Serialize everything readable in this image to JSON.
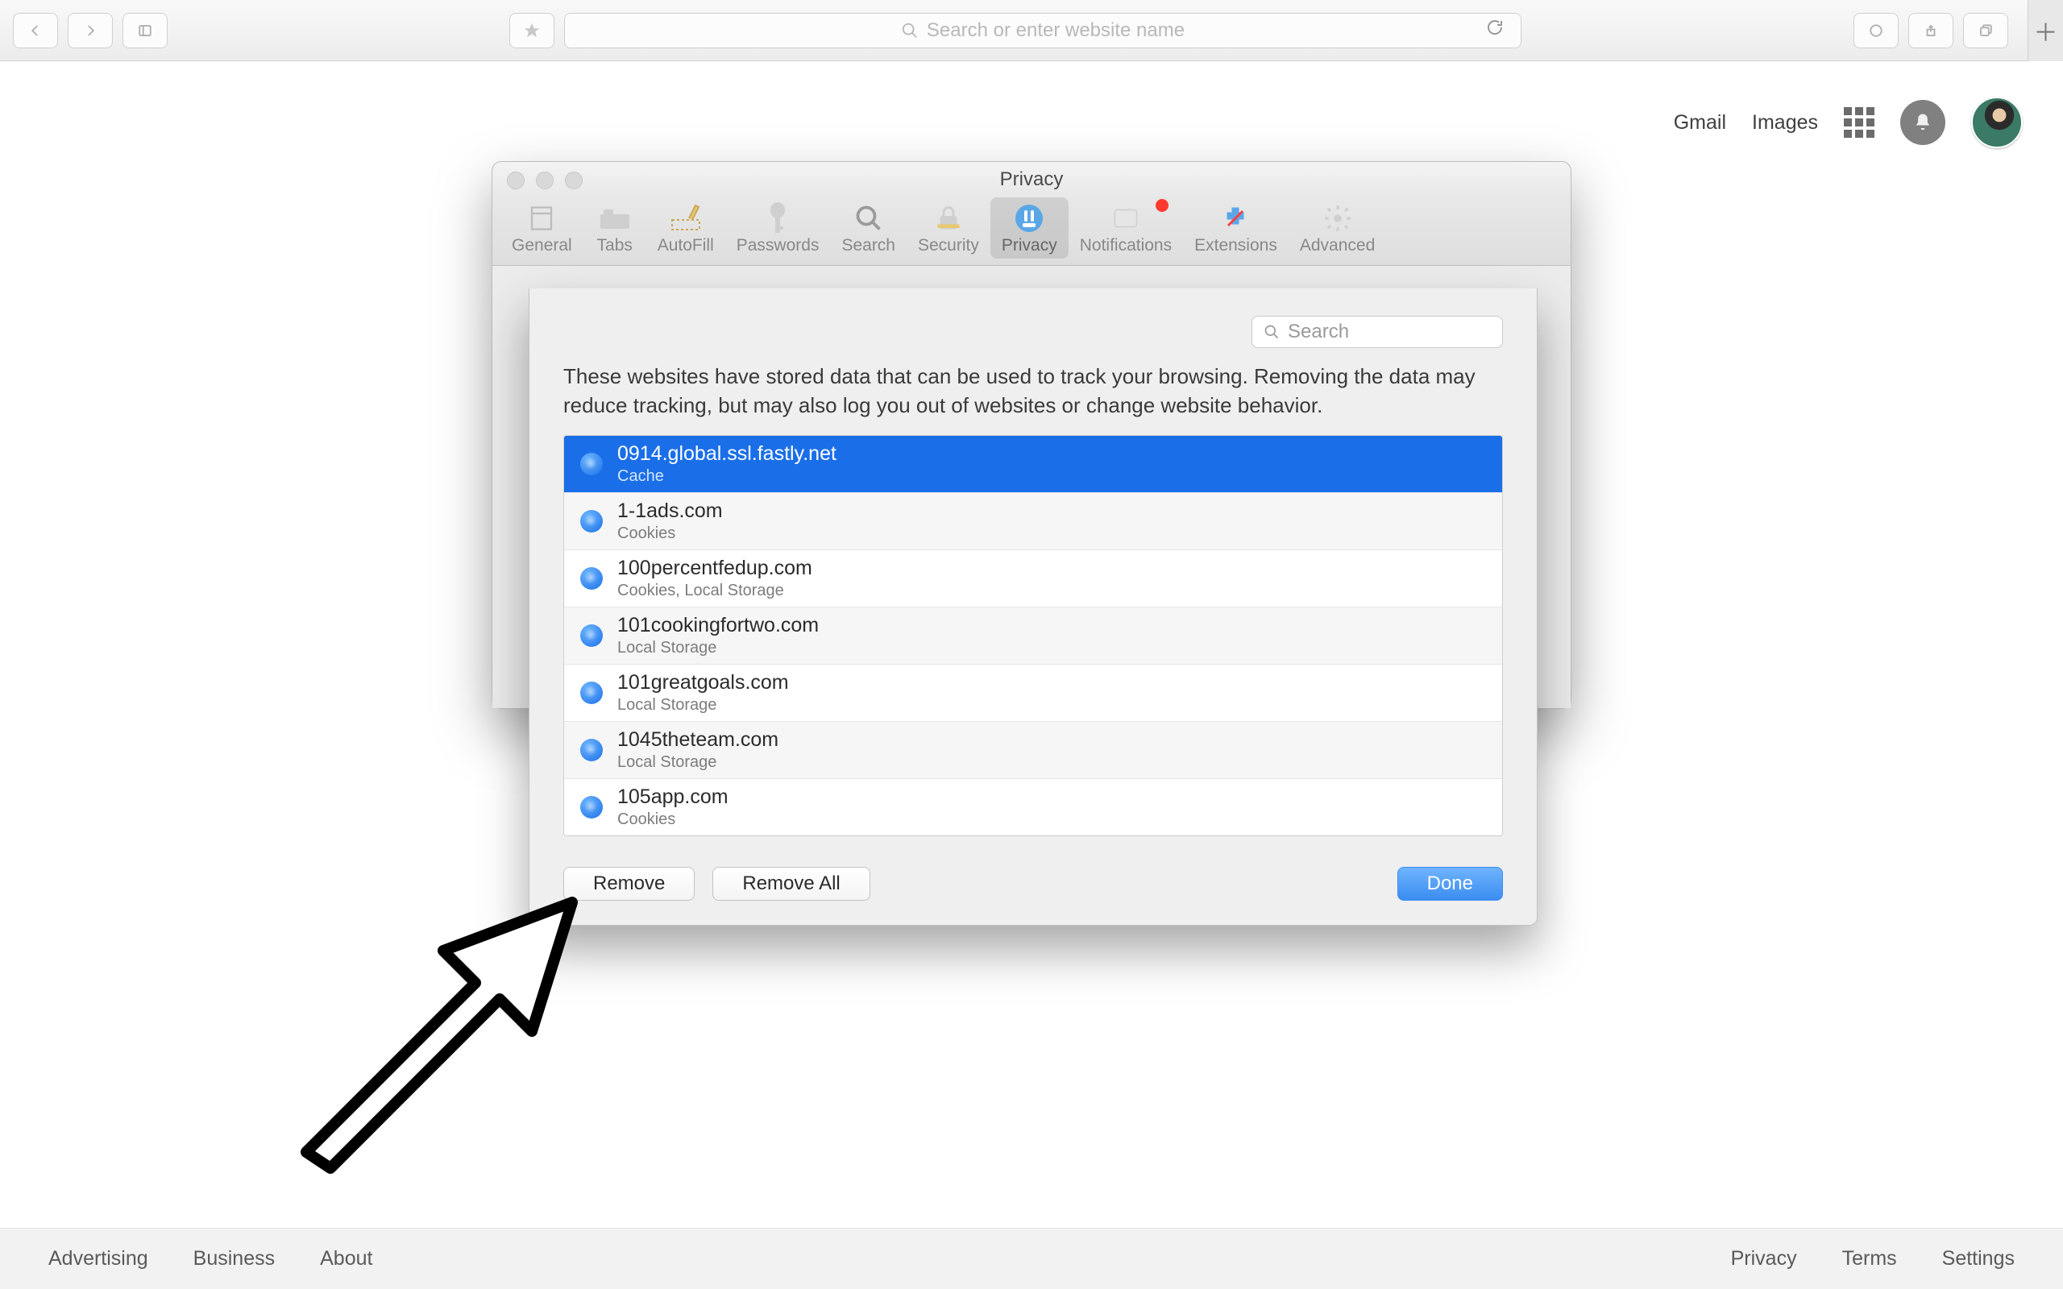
{
  "browser": {
    "url_placeholder": "Search or enter website name"
  },
  "google": {
    "header": {
      "gmail": "Gmail",
      "images": "Images"
    },
    "footer": {
      "advertising": "Advertising",
      "business": "Business",
      "about": "About",
      "privacy": "Privacy",
      "terms": "Terms",
      "settings": "Settings"
    }
  },
  "prefs": {
    "title": "Privacy",
    "tabs": {
      "general": "General",
      "tabs": "Tabs",
      "autofill": "AutoFill",
      "passwords": "Passwords",
      "search": "Search",
      "security": "Security",
      "privacy": "Privacy",
      "notifications": "Notifications",
      "extensions": "Extensions",
      "advanced": "Advanced"
    }
  },
  "sheet": {
    "search_placeholder": "Search",
    "description": "These websites have stored data that can be used to track your browsing. Removing the data may reduce tracking, but may also log you out of websites or change website behavior.",
    "sites": [
      {
        "domain": "0914.global.ssl.fastly.net",
        "detail": "Cache",
        "selected": true
      },
      {
        "domain": "1-1ads.com",
        "detail": "Cookies",
        "selected": false
      },
      {
        "domain": "100percentfedup.com",
        "detail": "Cookies, Local Storage",
        "selected": false
      },
      {
        "domain": "101cookingfortwo.com",
        "detail": "Local Storage",
        "selected": false
      },
      {
        "domain": "101greatgoals.com",
        "detail": "Local Storage",
        "selected": false
      },
      {
        "domain": "1045theteam.com",
        "detail": "Local Storage",
        "selected": false
      },
      {
        "domain": "105app.com",
        "detail": "Cookies",
        "selected": false
      }
    ],
    "buttons": {
      "remove": "Remove",
      "remove_all": "Remove All",
      "done": "Done"
    }
  }
}
